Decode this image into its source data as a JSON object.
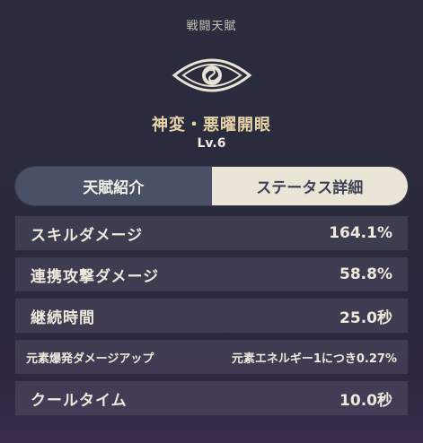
{
  "header": {
    "title": "戦闘天賦"
  },
  "skill": {
    "icon": "eye-emblem-icon",
    "name": "神変・悪曜開眼",
    "level": "Lv.6"
  },
  "tabs": [
    {
      "label": "天賦紹介",
      "active": false
    },
    {
      "label": "ステータス詳細",
      "active": true
    }
  ],
  "stats": [
    {
      "label": "スキルダメージ",
      "value": "164.1%"
    },
    {
      "label": "連携攻撃ダメージ",
      "value": "58.8%"
    },
    {
      "label": "継続時間",
      "value": "25.0秒"
    },
    {
      "label": "元素爆発ダメージアップ",
      "value": "元素エネルギー1につき0.27%"
    },
    {
      "label": "クールタイム",
      "value": "10.0秒"
    }
  ],
  "colors": {
    "accent_gold": "#e8d3a8",
    "tab_active_bg": "#ebe5d8",
    "tab_inactive_bg": "#4a5065"
  }
}
